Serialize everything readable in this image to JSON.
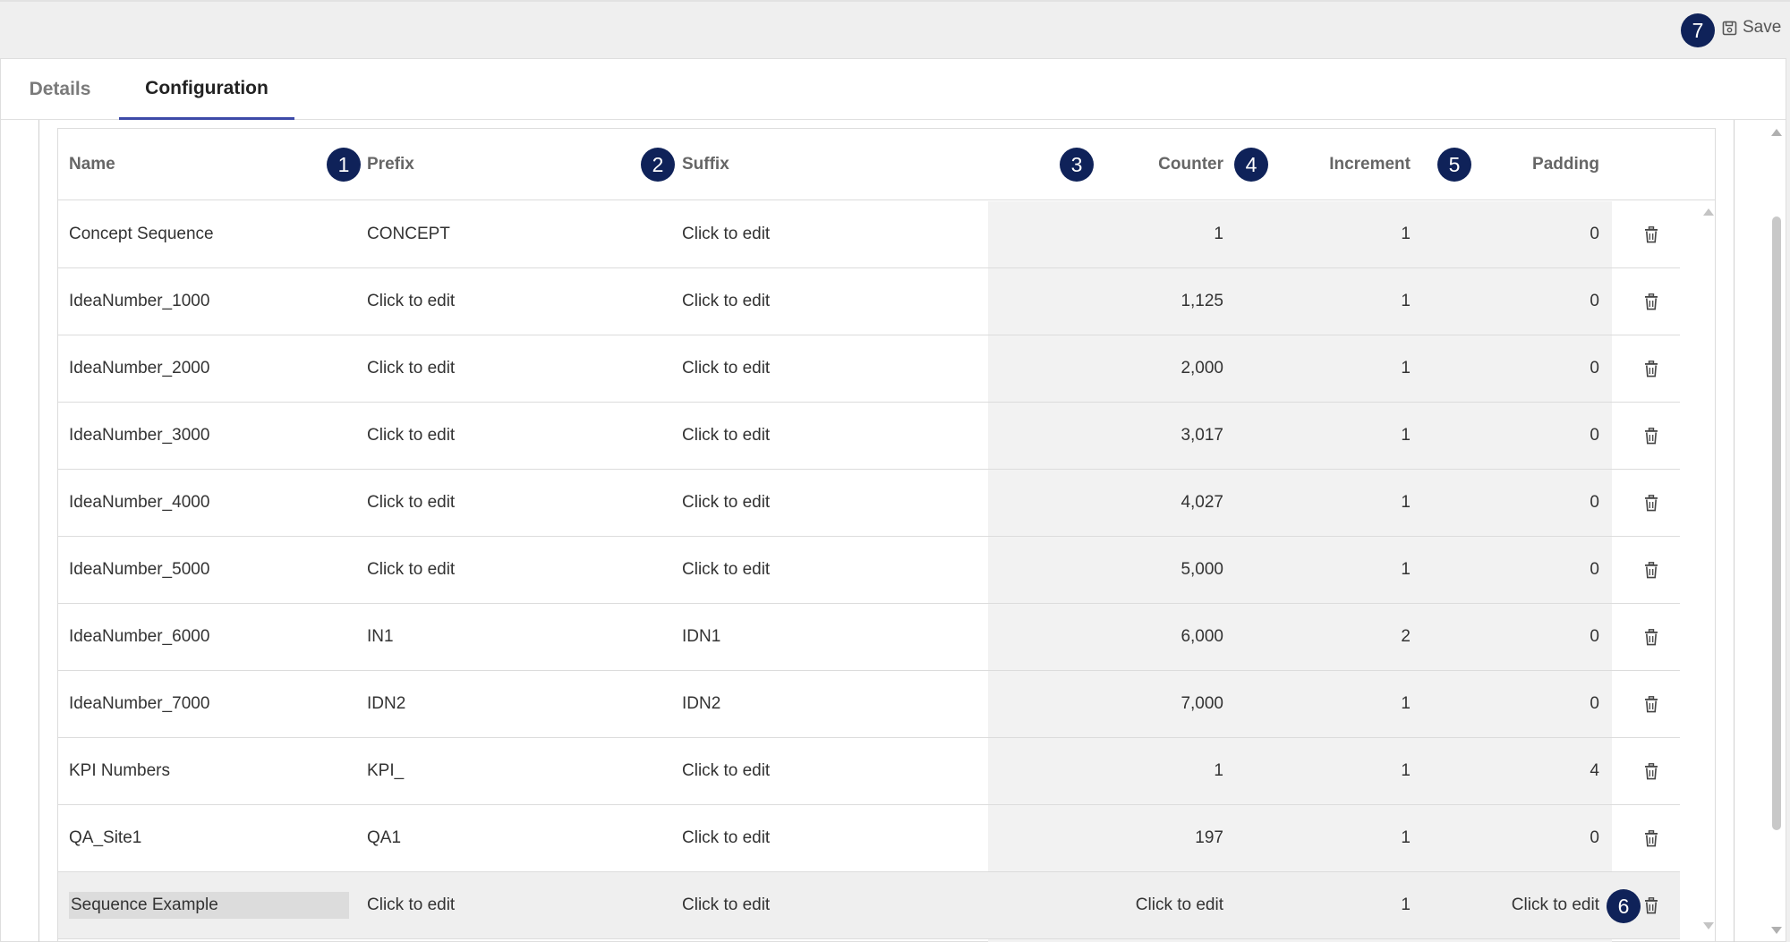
{
  "toolbar": {
    "save_label": "Save",
    "save_icon": "save-icon"
  },
  "tabs": [
    {
      "label": "Details",
      "active": false
    },
    {
      "label": "Configuration",
      "active": true
    }
  ],
  "callouts": [
    "1",
    "2",
    "3",
    "4",
    "5",
    "6",
    "7"
  ],
  "table": {
    "columns": {
      "name": "Name",
      "prefix": "Prefix",
      "suffix": "Suffix",
      "counter": "Counter",
      "increment": "Increment",
      "padding": "Padding"
    },
    "rows": [
      {
        "name": "Concept Sequence",
        "prefix": "CONCEPT",
        "suffix": "Click to edit",
        "counter": "1",
        "increment": "1",
        "padding": "0"
      },
      {
        "name": "IdeaNumber_1000",
        "prefix": "Click to edit",
        "suffix": "Click to edit",
        "counter": "1,125",
        "increment": "1",
        "padding": "0"
      },
      {
        "name": "IdeaNumber_2000",
        "prefix": "Click to edit",
        "suffix": "Click to edit",
        "counter": "2,000",
        "increment": "1",
        "padding": "0"
      },
      {
        "name": "IdeaNumber_3000",
        "prefix": "Click to edit",
        "suffix": "Click to edit",
        "counter": "3,017",
        "increment": "1",
        "padding": "0"
      },
      {
        "name": "IdeaNumber_4000",
        "prefix": "Click to edit",
        "suffix": "Click to edit",
        "counter": "4,027",
        "increment": "1",
        "padding": "0"
      },
      {
        "name": "IdeaNumber_5000",
        "prefix": "Click to edit",
        "suffix": "Click to edit",
        "counter": "5,000",
        "increment": "1",
        "padding": "0"
      },
      {
        "name": "IdeaNumber_6000",
        "prefix": "IN1",
        "suffix": "IDN1",
        "counter": "6,000",
        "increment": "2",
        "padding": "0"
      },
      {
        "name": "IdeaNumber_7000",
        "prefix": "IDN2",
        "suffix": "IDN2",
        "counter": "7,000",
        "increment": "1",
        "padding": "0"
      },
      {
        "name": "KPI Numbers",
        "prefix": "KPI_",
        "suffix": "Click to edit",
        "counter": "1",
        "increment": "1",
        "padding": "4"
      },
      {
        "name": "QA_Site1",
        "prefix": "QA1",
        "suffix": "Click to edit",
        "counter": "197",
        "increment": "1",
        "padding": "0"
      },
      {
        "name": "Sequence Example",
        "prefix": "Click to edit",
        "suffix": "Click to edit",
        "counter": "Click to edit",
        "increment": "1",
        "padding": "Click to edit",
        "selected": true
      }
    ]
  },
  "colors": {
    "badge": "#0f2259",
    "tab_underline": "#3d4aa8",
    "shaded_column": "#f2f2f2"
  }
}
